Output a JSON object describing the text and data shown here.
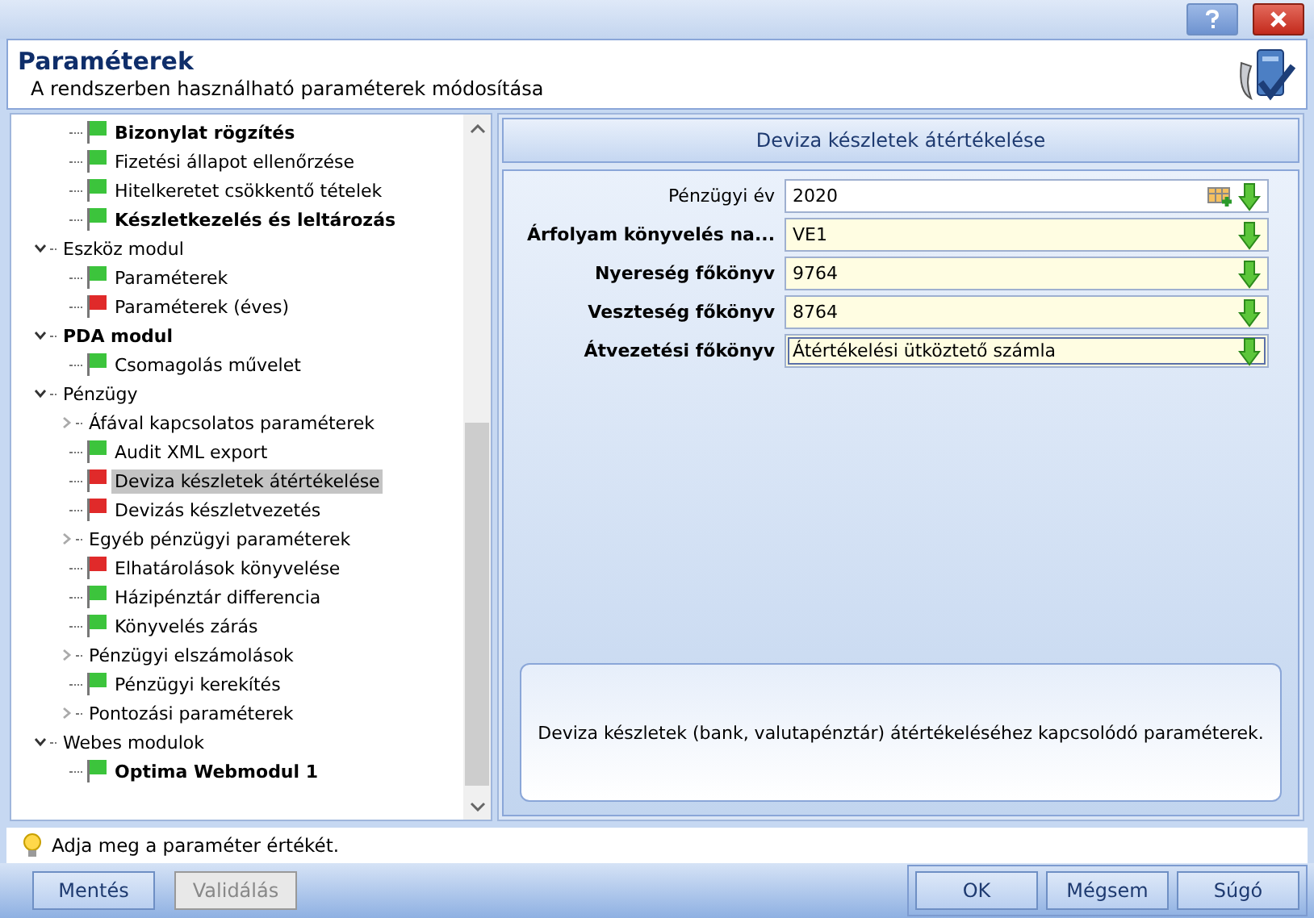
{
  "window": {
    "title": "Paraméterek",
    "subtitle": "A rendszerben használható paraméterek módosítása"
  },
  "tree": [
    {
      "kind": "leaf",
      "label": "Bizonylat rögzítés",
      "bold": true,
      "color": "#3cc43c",
      "selected": false
    },
    {
      "kind": "leaf",
      "label": "Fizetési állapot ellenőrzése",
      "bold": false,
      "color": "#3cc43c",
      "selected": false
    },
    {
      "kind": "leaf",
      "label": "Hitelkeretet csökkentő tételek",
      "bold": false,
      "color": "#3cc43c",
      "selected": false
    },
    {
      "kind": "leaf",
      "label": "Készletkezelés és leltározás",
      "bold": true,
      "color": "#3cc43c",
      "selected": false
    },
    {
      "kind": "group",
      "label": "Eszköz modul",
      "bold": false,
      "expanded": true,
      "children": [
        {
          "kind": "leaf",
          "label": "Paraméterek",
          "bold": false,
          "color": "#3cc43c",
          "selected": false
        },
        {
          "kind": "leaf",
          "label": "Paraméterek (éves)",
          "bold": false,
          "color": "#e02a2a",
          "selected": false
        }
      ]
    },
    {
      "kind": "group",
      "label": "PDA modul",
      "bold": true,
      "expanded": true,
      "children": [
        {
          "kind": "leaf",
          "label": "Csomagolás művelet",
          "bold": false,
          "color": "#3cc43c",
          "selected": false
        }
      ]
    },
    {
      "kind": "group",
      "label": "Pénzügy",
      "bold": false,
      "expanded": true,
      "children": [
        {
          "kind": "group",
          "label": "Áfával kapcsolatos paraméterek",
          "bold": false,
          "expanded": false
        },
        {
          "kind": "leaf",
          "label": "Audit XML export",
          "bold": false,
          "color": "#3cc43c",
          "selected": false
        },
        {
          "kind": "leaf",
          "label": "Deviza készletek átértékelése",
          "bold": false,
          "color": "#e02a2a",
          "selected": true
        },
        {
          "kind": "leaf",
          "label": "Devizás készletvezetés",
          "bold": false,
          "color": "#e02a2a",
          "selected": false
        },
        {
          "kind": "group",
          "label": "Egyéb pénzügyi paraméterek",
          "bold": false,
          "expanded": false
        },
        {
          "kind": "leaf",
          "label": "Elhatárolások könyvelése",
          "bold": false,
          "color": "#e02a2a",
          "selected": false
        },
        {
          "kind": "leaf",
          "label": "Házipénztár differencia",
          "bold": false,
          "color": "#3cc43c",
          "selected": false
        },
        {
          "kind": "leaf",
          "label": "Könyvelés zárás",
          "bold": false,
          "color": "#3cc43c",
          "selected": false
        },
        {
          "kind": "group",
          "label": "Pénzügyi elszámolások",
          "bold": false,
          "expanded": false
        },
        {
          "kind": "leaf",
          "label": "Pénzügyi kerekítés",
          "bold": false,
          "color": "#3cc43c",
          "selected": false
        },
        {
          "kind": "group",
          "label": "Pontozási paraméterek",
          "bold": false,
          "expanded": false
        }
      ]
    },
    {
      "kind": "group",
      "label": "Webes modulok",
      "bold": false,
      "expanded": true,
      "children": [
        {
          "kind": "leaf",
          "label": "Optima Webmodul 1",
          "bold": true,
          "color": "#3cc43c",
          "selected": false
        }
      ]
    }
  ],
  "panel": {
    "title": "Deviza készletek átértékelése",
    "fields": [
      {
        "label": "Pénzügyi év",
        "value": "2020",
        "required": false,
        "focused": false,
        "picker": true
      },
      {
        "label": "Árfolyam könyvelés na...",
        "value": "VE1",
        "required": true,
        "focused": false,
        "picker": false
      },
      {
        "label": "Nyereség főkönyv",
        "value": "9764",
        "required": true,
        "focused": false,
        "picker": false
      },
      {
        "label": "Veszteség főkönyv",
        "value": "8764",
        "required": true,
        "focused": false,
        "picker": false
      },
      {
        "label": "Átvezetési főkönyv",
        "value": "Átértékelési ütköztető számla",
        "required": true,
        "focused": true,
        "picker": false
      }
    ],
    "description": "Deviza készletek (bank, valutapénztár) átértékeléséhez kapcsolódó paraméterek."
  },
  "status_bar": "Adja meg a paraméter értékét.",
  "buttons_left": [
    {
      "label": "Mentés",
      "disabled": false
    },
    {
      "label": "Validálás",
      "disabled": true
    }
  ],
  "buttons_right": [
    {
      "label": "OK",
      "disabled": false
    },
    {
      "label": "Mégsem",
      "disabled": false
    },
    {
      "label": "Súgó",
      "disabled": false
    }
  ]
}
